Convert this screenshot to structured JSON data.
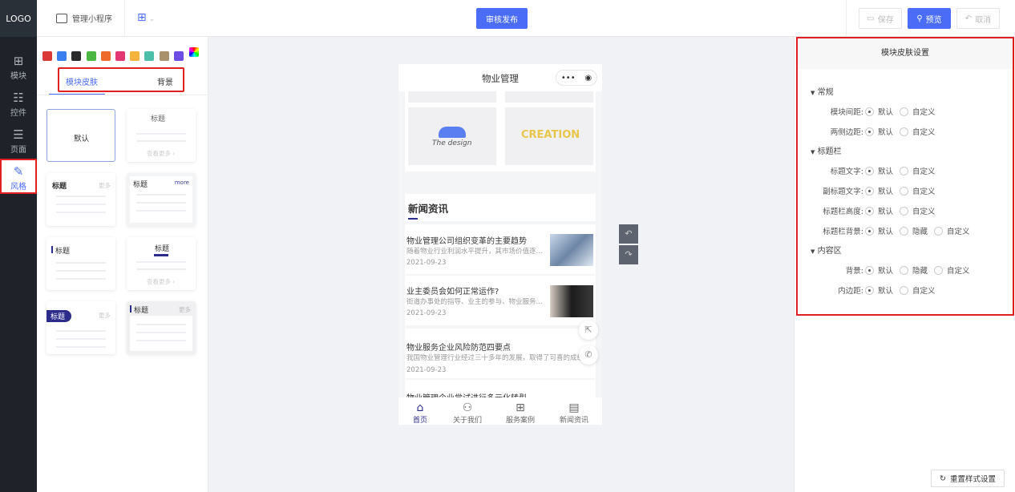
{
  "header": {
    "logo": "LOGO",
    "app_label": "管理小程序",
    "publish": "审核发布",
    "save": "保存",
    "preview": "预览",
    "cancel": "取消"
  },
  "sidebar": {
    "items": [
      {
        "label": "模块",
        "icon": "plus-square-icon"
      },
      {
        "label": "控件",
        "icon": "sliders-icon"
      },
      {
        "label": "页面",
        "icon": "layout-icon"
      },
      {
        "label": "风格",
        "icon": "magic-wand-icon"
      }
    ]
  },
  "panel": {
    "colors": [
      "#d93a35",
      "#3a7ff0",
      "#2b2b2b",
      "#4cb843",
      "#ee6a2b",
      "#e33673",
      "#f3b23b",
      "#4bbfa8",
      "#a9926b",
      "#6b4de6"
    ],
    "tabs": [
      "模块皮肤",
      "背景"
    ],
    "cards": {
      "default": "默认",
      "title": "标题",
      "more": "更多",
      "more_en": "more",
      "view_more": "查看更多 ›"
    }
  },
  "phone": {
    "title": "物业管理",
    "logo1": "The design",
    "logo2": "CREATION",
    "section": "新闻资讯",
    "news": [
      {
        "title": "物业管理公司组织变革的主要趋势",
        "desc": "随着物业行业利润水平提升，其市场价值逐...",
        "date": "2021-09-23"
      },
      {
        "title": "业主委员会如何正常运作?",
        "desc": "街道办事处的指导、业主的参与、物业服务...",
        "date": "2021-09-23"
      },
      {
        "title": "物业服务企业风险防范四要点",
        "desc": "我国物业管理行业经过三十多年的发展，取得了可喜的成绩，",
        "date": "2021-09-23"
      },
      {
        "title": "物业管理企业尝试进行多元化转型"
      }
    ],
    "tabs": [
      "首页",
      "关于我们",
      "服务案例",
      "新闻资讯"
    ]
  },
  "settings": {
    "title": "模块皮肤设置",
    "reset": "重置样式设置",
    "sections": [
      {
        "name": "常规",
        "rows": [
          {
            "label": "模块间距:",
            "options": [
              "默认",
              "自定义"
            ]
          },
          {
            "label": "两侧边距:",
            "options": [
              "默认",
              "自定义"
            ]
          }
        ]
      },
      {
        "name": "标题栏",
        "rows": [
          {
            "label": "标题文字:",
            "options": [
              "默认",
              "自定义"
            ]
          },
          {
            "label": "副标题文字:",
            "options": [
              "默认",
              "自定义"
            ]
          },
          {
            "label": "标题栏高度:",
            "options": [
              "默认",
              "自定义"
            ]
          },
          {
            "label": "标题栏背景:",
            "options": [
              "默认",
              "隐藏",
              "自定义"
            ]
          }
        ]
      },
      {
        "name": "内容区",
        "rows": [
          {
            "label": "背景:",
            "options": [
              "默认",
              "隐藏",
              "自定义"
            ]
          },
          {
            "label": "内边距:",
            "options": [
              "默认",
              "自定义"
            ]
          }
        ]
      }
    ]
  }
}
